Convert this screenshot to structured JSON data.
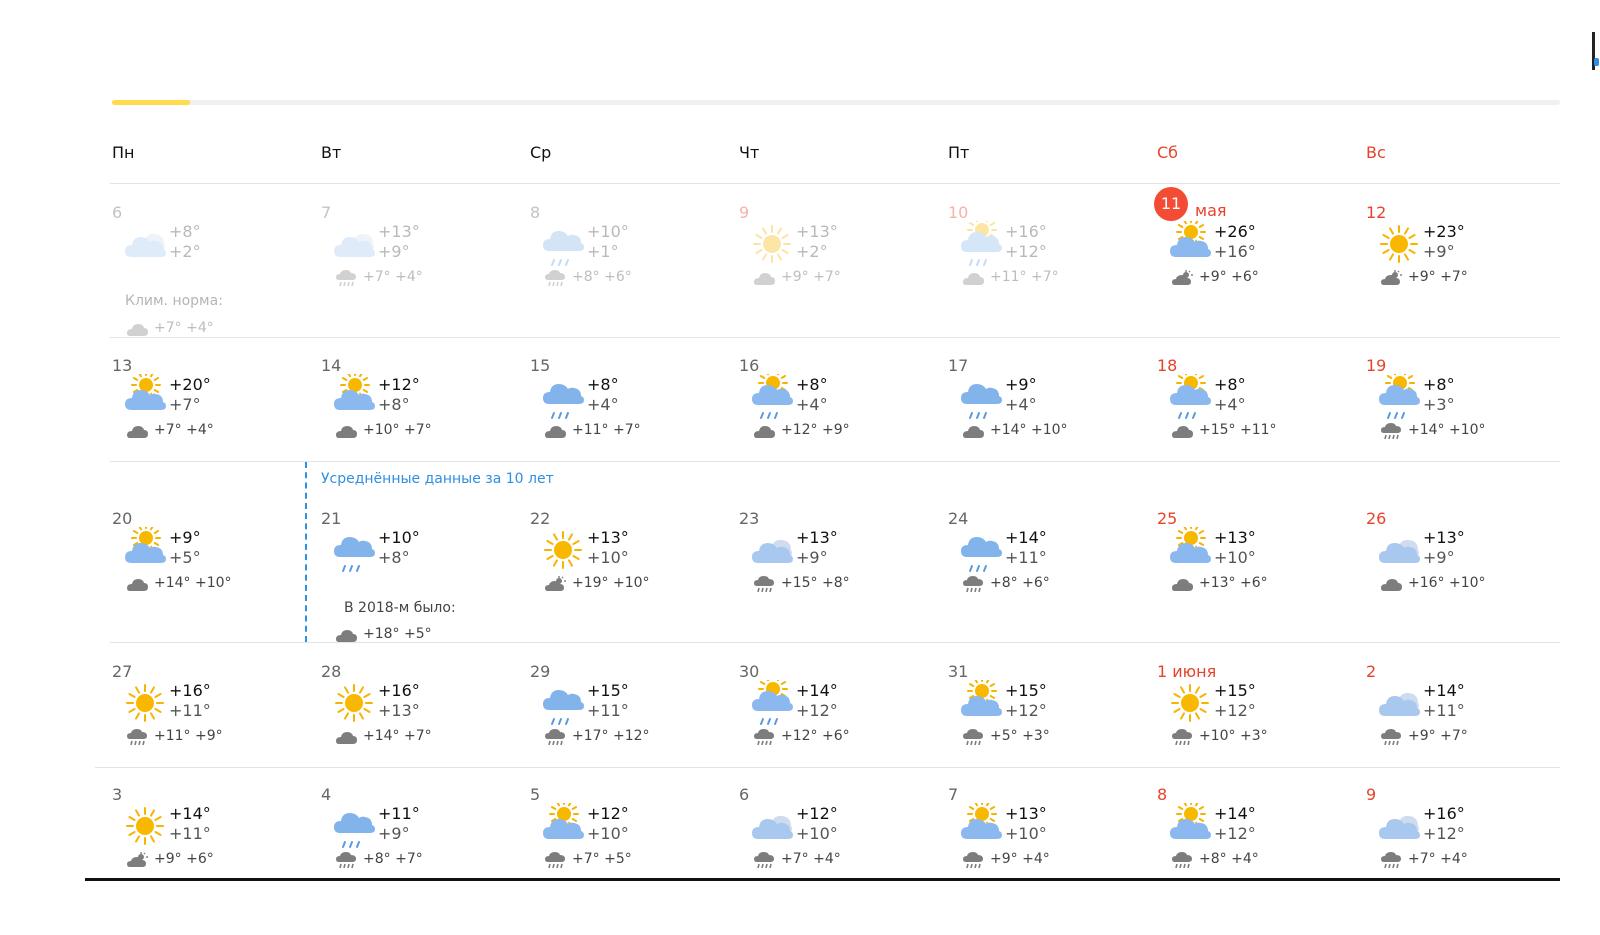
{
  "weekdays": [
    {
      "label": "Пн",
      "weekend": false
    },
    {
      "label": "Вт",
      "weekend": false
    },
    {
      "label": "Ср",
      "weekend": false
    },
    {
      "label": "Чт",
      "weekend": false
    },
    {
      "label": "Пт",
      "weekend": false
    },
    {
      "label": "Сб",
      "weekend": true
    },
    {
      "label": "Вс",
      "weekend": true
    }
  ],
  "avg_note": "Усреднённые данные за 10 лет",
  "weeks": [
    [
      {
        "day": "6",
        "icon": "cloudy",
        "t_day": "+8°",
        "t_night": "+2°",
        "sub_icon": "cloud",
        "sub": "",
        "past": true,
        "clim_label": "Клим. норма:",
        "clim": "+7° +4°",
        "clim_icon": "cloud"
      },
      {
        "day": "7",
        "icon": "cloudy",
        "t_day": "+13°",
        "t_night": "+9°",
        "sub_icon": "rain",
        "sub": "+7° +4°",
        "past": true
      },
      {
        "day": "8",
        "icon": "rain-cloud",
        "t_day": "+10°",
        "t_night": "+1°",
        "sub_icon": "rain",
        "sub": "+8° +6°",
        "past": true
      },
      {
        "day": "9",
        "icon": "sun",
        "t_day": "+13°",
        "t_night": "+2°",
        "sub_icon": "cloud",
        "sub": "+9° +7°",
        "past": true,
        "weekend": true
      },
      {
        "day": "10",
        "icon": "sun-cloud-rain",
        "t_day": "+16°",
        "t_night": "+12°",
        "sub_icon": "cloud",
        "sub": "+11° +7°",
        "past": true,
        "weekend": true
      },
      {
        "day": "11",
        "month": "мая",
        "today": true,
        "icon": "sun-cloud",
        "t_day": "+26°",
        "t_night": "+16°",
        "sub_icon": "sun-cloud",
        "sub": "+9° +6°",
        "weekend": true
      },
      {
        "day": "12",
        "icon": "sun",
        "t_day": "+23°",
        "t_night": "+9°",
        "sub_icon": "sun-cloud",
        "sub": "+9° +7°",
        "weekend": true
      }
    ],
    [
      {
        "day": "13",
        "icon": "sun-cloud",
        "t_day": "+20°",
        "t_night": "+7°",
        "sub_icon": "cloud",
        "sub": "+7° +4°"
      },
      {
        "day": "14",
        "icon": "sun-cloud",
        "t_day": "+12°",
        "t_night": "+8°",
        "sub_icon": "cloud",
        "sub": "+10° +7°"
      },
      {
        "day": "15",
        "icon": "rain-cloud",
        "t_day": "+8°",
        "t_night": "+4°",
        "sub_icon": "cloud",
        "sub": "+11° +7°"
      },
      {
        "day": "16",
        "icon": "sun-cloud-rain",
        "t_day": "+8°",
        "t_night": "+4°",
        "sub_icon": "cloud",
        "sub": "+12° +9°"
      },
      {
        "day": "17",
        "icon": "rain-cloud",
        "t_day": "+9°",
        "t_night": "+4°",
        "sub_icon": "cloud",
        "sub": "+14° +10°"
      },
      {
        "day": "18",
        "icon": "sun-cloud-rain",
        "t_day": "+8°",
        "t_night": "+4°",
        "sub_icon": "cloud",
        "sub": "+15° +11°",
        "weekend": true
      },
      {
        "day": "19",
        "icon": "sun-cloud-rain",
        "t_day": "+8°",
        "t_night": "+3°",
        "sub_icon": "rain",
        "sub": "+14° +10°",
        "weekend": true
      }
    ],
    [
      {
        "day": "20",
        "icon": "sun-cloud",
        "t_day": "+9°",
        "t_night": "+5°",
        "sub_icon": "cloud",
        "sub": "+14° +10°"
      },
      {
        "day": "21",
        "icon": "rain-cloud",
        "t_day": "+10°",
        "t_night": "+8°",
        "sub_icon": "none",
        "sub": "",
        "hist_label": "В 2018-м было:",
        "hist": "+18° +5°",
        "hist_icon": "cloud"
      },
      {
        "day": "22",
        "icon": "sun",
        "t_day": "+13°",
        "t_night": "+10°",
        "sub_icon": "sun-cloud",
        "sub": "+19° +10°"
      },
      {
        "day": "23",
        "icon": "cloudy",
        "t_day": "+13°",
        "t_night": "+9°",
        "sub_icon": "rain",
        "sub": "+15° +8°"
      },
      {
        "day": "24",
        "icon": "rain-cloud",
        "t_day": "+14°",
        "t_night": "+11°",
        "sub_icon": "rain",
        "sub": "+8° +6°"
      },
      {
        "day": "25",
        "icon": "sun-cloud",
        "t_day": "+13°",
        "t_night": "+10°",
        "sub_icon": "cloud",
        "sub": "+13° +6°",
        "weekend": true
      },
      {
        "day": "26",
        "icon": "cloudy",
        "t_day": "+13°",
        "t_night": "+9°",
        "sub_icon": "cloud",
        "sub": "+16° +10°",
        "weekend": true
      }
    ],
    [
      {
        "day": "27",
        "icon": "sun",
        "t_day": "+16°",
        "t_night": "+11°",
        "sub_icon": "rain",
        "sub": "+11° +9°"
      },
      {
        "day": "28",
        "icon": "sun",
        "t_day": "+16°",
        "t_night": "+13°",
        "sub_icon": "cloud",
        "sub": "+14° +7°"
      },
      {
        "day": "29",
        "icon": "rain-cloud",
        "t_day": "+15°",
        "t_night": "+11°",
        "sub_icon": "rain",
        "sub": "+17° +12°"
      },
      {
        "day": "30",
        "icon": "sun-cloud-rain",
        "t_day": "+14°",
        "t_night": "+12°",
        "sub_icon": "rain",
        "sub": "+12° +6°"
      },
      {
        "day": "31",
        "icon": "sun-cloud",
        "t_day": "+15°",
        "t_night": "+12°",
        "sub_icon": "rain",
        "sub": "+5° +3°"
      },
      {
        "day": "1 июня",
        "icon": "sun",
        "t_day": "+15°",
        "t_night": "+12°",
        "sub_icon": "rain",
        "sub": "+10° +3°",
        "weekend": true
      },
      {
        "day": "2",
        "icon": "cloudy",
        "t_day": "+14°",
        "t_night": "+11°",
        "sub_icon": "rain",
        "sub": "+9° +7°",
        "weekend": true
      }
    ],
    [
      {
        "day": "3",
        "icon": "sun",
        "t_day": "+14°",
        "t_night": "+11°",
        "sub_icon": "sun-cloud",
        "sub": "+9° +6°"
      },
      {
        "day": "4",
        "icon": "rain-cloud",
        "t_day": "+11°",
        "t_night": "+9°",
        "sub_icon": "rain",
        "sub": "+8° +7°"
      },
      {
        "day": "5",
        "icon": "sun-cloud",
        "t_day": "+12°",
        "t_night": "+10°",
        "sub_icon": "rain",
        "sub": "+7° +5°"
      },
      {
        "day": "6",
        "icon": "cloudy",
        "t_day": "+12°",
        "t_night": "+10°",
        "sub_icon": "rain",
        "sub": "+7° +4°"
      },
      {
        "day": "7",
        "icon": "sun-cloud",
        "t_day": "+13°",
        "t_night": "+10°",
        "sub_icon": "rain",
        "sub": "+9° +4°"
      },
      {
        "day": "8",
        "icon": "sun-cloud",
        "t_day": "+14°",
        "t_night": "+12°",
        "sub_icon": "rain",
        "sub": "+8° +4°",
        "weekend": true
      },
      {
        "day": "9",
        "icon": "cloudy",
        "t_day": "+16°",
        "t_night": "+12°",
        "sub_icon": "rain",
        "sub": "+7° +4°",
        "weekend": true
      }
    ]
  ]
}
